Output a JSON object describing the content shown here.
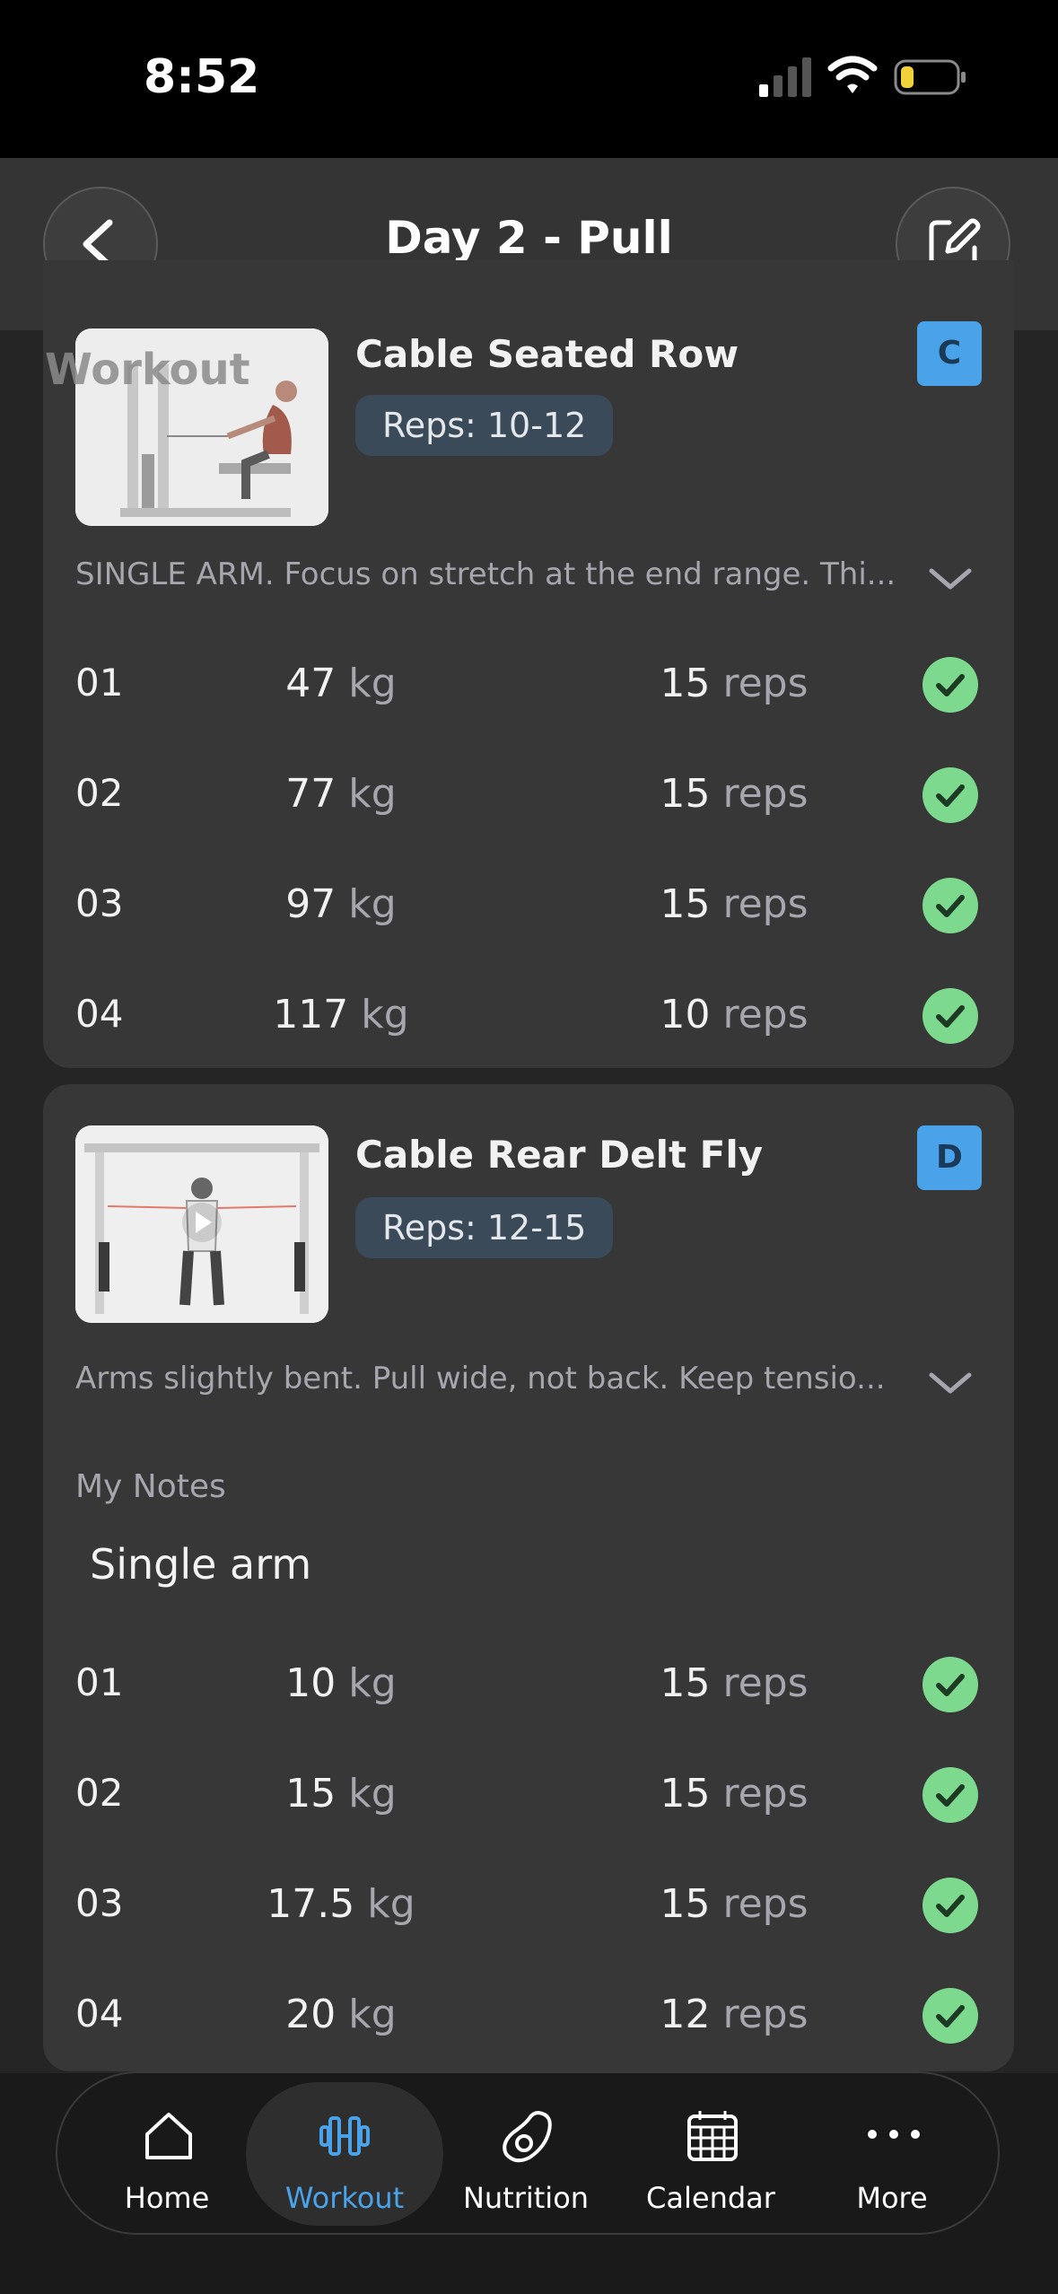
{
  "status": {
    "time": "8:52"
  },
  "header": {
    "title": "Day 2 - Pull"
  },
  "ghost_label": "Workout",
  "exercises": [
    {
      "name": "Cable Seated Row",
      "reps_target": "Reps: 10-12",
      "badge": "C",
      "description": "SINGLE ARM. Focus on stretch at the end range. Thi...",
      "sets": [
        {
          "num": "01",
          "weight": "47",
          "weight_unit": "kg",
          "reps": "15",
          "reps_unit": "reps"
        },
        {
          "num": "02",
          "weight": "77",
          "weight_unit": "kg",
          "reps": "15",
          "reps_unit": "reps"
        },
        {
          "num": "03",
          "weight": "97",
          "weight_unit": "kg",
          "reps": "15",
          "reps_unit": "reps"
        },
        {
          "num": "04",
          "weight": "117",
          "weight_unit": "kg",
          "reps": "10",
          "reps_unit": "reps"
        }
      ]
    },
    {
      "name": "Cable Rear Delt Fly",
      "reps_target": "Reps: 12-15",
      "badge": "D",
      "description": "Arms slightly bent. Pull wide, not back. Keep tensio...",
      "notes_label": "My Notes",
      "notes_value": "Single arm",
      "sets": [
        {
          "num": "01",
          "weight": "10",
          "weight_unit": "kg",
          "reps": "15",
          "reps_unit": "reps"
        },
        {
          "num": "02",
          "weight": "15",
          "weight_unit": "kg",
          "reps": "15",
          "reps_unit": "reps"
        },
        {
          "num": "03",
          "weight": "17.5",
          "weight_unit": "kg",
          "reps": "15",
          "reps_unit": "reps"
        },
        {
          "num": "04",
          "weight": "20",
          "weight_unit": "kg",
          "reps": "12",
          "reps_unit": "reps"
        }
      ]
    }
  ],
  "tabs": [
    {
      "label": "Home",
      "icon": "home-icon"
    },
    {
      "label": "Workout",
      "icon": "dumbbell-icon",
      "active": true
    },
    {
      "label": "Nutrition",
      "icon": "avocado-icon"
    },
    {
      "label": "Calendar",
      "icon": "calendar-icon"
    },
    {
      "label": "More",
      "icon": "more-icon"
    }
  ],
  "colors": {
    "accent": "#4aa3e8",
    "check": "#7dd98e",
    "background": "#252525",
    "card": "#373737"
  }
}
